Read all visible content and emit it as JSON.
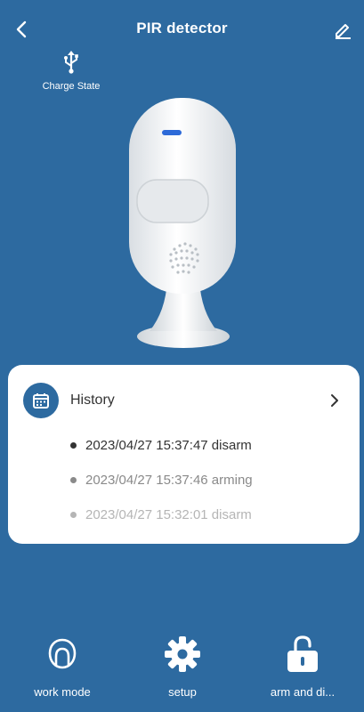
{
  "header": {
    "title": "PIR detector",
    "back_icon": "chevron-left-icon",
    "edit_icon": "pencil-icon"
  },
  "charge": {
    "label": "Charge State",
    "icon": "usb-icon"
  },
  "history": {
    "title": "History",
    "icon": "calendar-icon",
    "items": [
      {
        "text": "2023/04/27 15:37:47 disarm",
        "color": "#333333"
      },
      {
        "text": "2023/04/27 15:37:46 arming",
        "color": "#8a8a8a"
      },
      {
        "text": "2023/04/27 15:32:01 disarm",
        "color": "#b5b5b5"
      }
    ]
  },
  "bottom": {
    "work_mode": "work mode",
    "setup": "setup",
    "arm": "arm and di..."
  },
  "colors": {
    "background": "#2d6aa0",
    "card": "#ffffff",
    "text_primary": "#333333"
  }
}
